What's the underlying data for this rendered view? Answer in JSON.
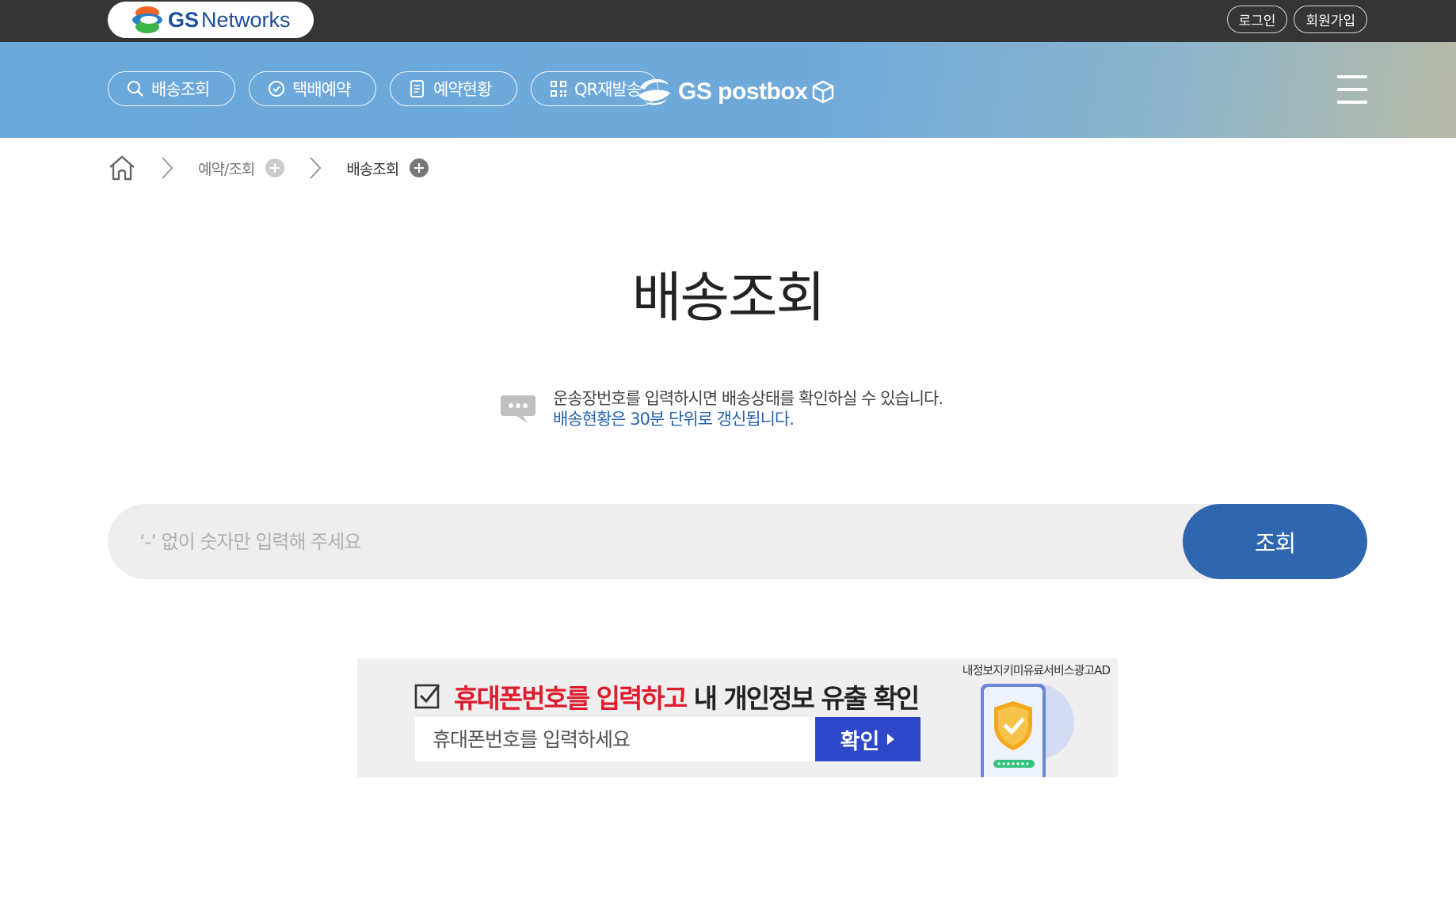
{
  "header": {
    "logo": {
      "brand_bold": "GS",
      "brand_rest": "Networks",
      "icon": "gs-logo-icon"
    },
    "top_links": [
      {
        "label": "로그인"
      },
      {
        "label": "회원가입"
      }
    ]
  },
  "nav": {
    "items": [
      {
        "label": "배송조회",
        "icon": "search-icon"
      },
      {
        "label": "택배예약",
        "icon": "clock-icon"
      },
      {
        "label": "예약현황",
        "icon": "document-icon"
      },
      {
        "label": "QR재발송",
        "icon": "qr-icon"
      }
    ],
    "postbox_logo": {
      "text": "GS postbox",
      "icon": "box-icon"
    },
    "menu_icon": "hamburger-icon"
  },
  "breadcrumb": {
    "home_icon": "home-icon",
    "items": [
      {
        "label": "예약/조회"
      },
      {
        "label": "배송조회"
      }
    ]
  },
  "page": {
    "title": "배송조회"
  },
  "notice": {
    "icon": "speech-bubble-icon",
    "line1": "운송장번호를 입력하시면 배송상태를 확인하실 수 있습니다.",
    "line2": "배송현황은 30분 단위로 갱신됩니다."
  },
  "search": {
    "placeholder": "‘-’ 없이 숫자만 입력해 주세요",
    "value": "",
    "button_label": "조회"
  },
  "ad": {
    "label": "내정보지키미유료서비스광고AD",
    "headline_red": "휴대폰번호를 입력하고",
    "headline_dark": " 내 개인정보 유출 확인",
    "input_placeholder": "휴대폰번호를 입력하세요",
    "button_label": "확인",
    "colors": {
      "red": "#e01b2d",
      "button": "#2e48c9"
    }
  },
  "colors": {
    "topbar": "#353535",
    "nav_band": "#6fa9da",
    "accent": "#2f66b0",
    "notice_blue": "#2563b0"
  }
}
